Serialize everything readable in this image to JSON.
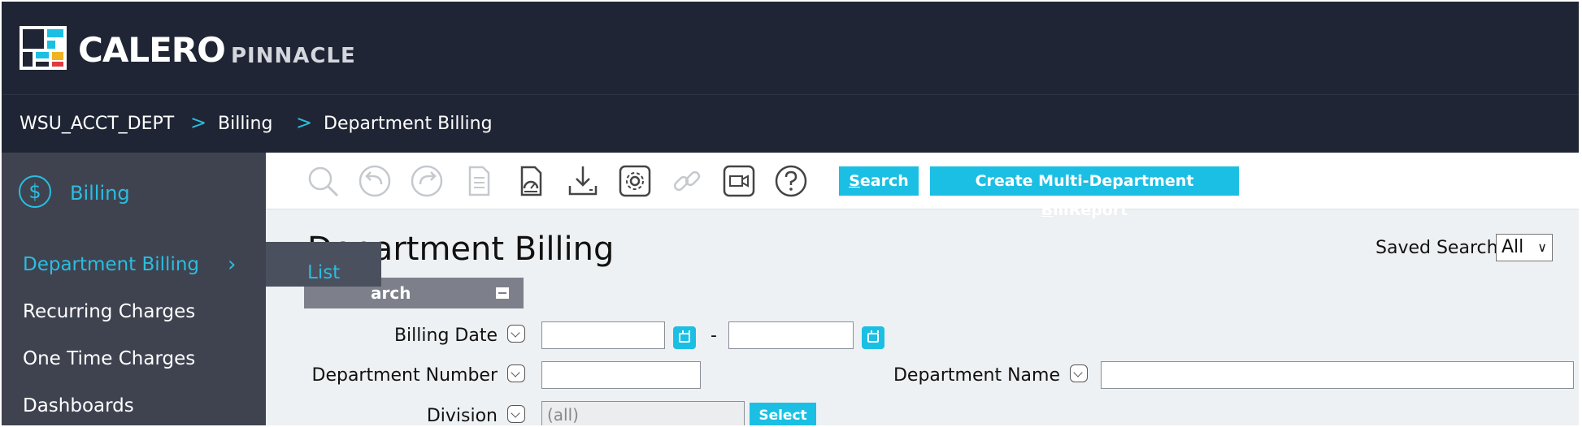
{
  "brand": {
    "name": "CALERO",
    "product": "PINNACLE"
  },
  "breadcrumb": [
    "WSU_ACCT_DEPT",
    "Billing",
    "Department Billing"
  ],
  "breadcrumb_separator": ">",
  "sidebar": {
    "section_title": "Billing",
    "section_icon": "dollar-icon",
    "items": [
      {
        "label": "Department Billing",
        "active": true
      },
      {
        "label": "Recurring Charges"
      },
      {
        "label": "One Time Charges"
      },
      {
        "label": "Dashboards"
      }
    ],
    "flyout": {
      "label": "List"
    }
  },
  "toolbar": {
    "icons": [
      "search-icon",
      "undo-icon",
      "redo-icon",
      "document-icon",
      "report-icon",
      "download-icon",
      "settings-icon",
      "link-icon",
      "video-icon",
      "help-icon"
    ],
    "search_button": {
      "label": "Search",
      "underline": "S",
      "rest": "earch"
    },
    "create_button": {
      "label": "Create Multi-Department BillReport",
      "pre": "Create Multi-Department ",
      "underline": "B",
      "rest": "illReport"
    }
  },
  "page": {
    "title": "Department Billing",
    "saved_search": {
      "label": "Saved Search",
      "value": "All"
    }
  },
  "search_panel": {
    "header": "arch",
    "fields": {
      "billing_date": {
        "label": "Billing Date",
        "from": "",
        "to": "",
        "separator": "-"
      },
      "department_number": {
        "label": "Department Number",
        "value": ""
      },
      "department_name": {
        "label": "Department Name",
        "value": ""
      },
      "division": {
        "label": "Division",
        "value": "(all)",
        "button": "Select"
      }
    }
  },
  "colors": {
    "header_bg": "#1f2534",
    "sidebar_bg": "#3f4350",
    "accent": "#1bbfe3",
    "panel_header": "#7d808a"
  }
}
